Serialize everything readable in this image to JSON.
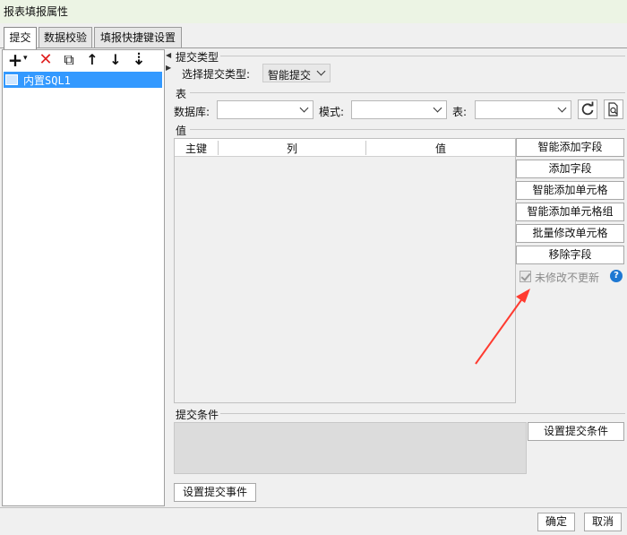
{
  "window": {
    "title": "报表填报属性"
  },
  "tabs": [
    {
      "label": "提交",
      "active": true
    },
    {
      "label": "数据校验",
      "active": false
    },
    {
      "label": "填报快捷键设置",
      "active": false
    }
  ],
  "toolbar": {
    "add": "+",
    "add_dropdown": "▾",
    "delete": "✕",
    "copy": "⧉",
    "move_up": "↑",
    "move_down": "↓",
    "sort": "⇣"
  },
  "tree": {
    "items": [
      {
        "label": "内置SQL1",
        "selected": true
      }
    ]
  },
  "submit_type": {
    "section_title": "提交类型",
    "label": "选择提交类型:",
    "value": "智能提交"
  },
  "table": {
    "section_title": "表",
    "database_label": "数据库:",
    "database_value": "",
    "schema_label": "模式:",
    "schema_value": "",
    "table_label": "表:",
    "table_value": ""
  },
  "values": {
    "section_title": "值",
    "columns": [
      "主键",
      "列",
      "值"
    ],
    "rows": []
  },
  "side_buttons": [
    "智能添加字段",
    "添加字段",
    "智能添加单元格",
    "智能添加单元格组",
    "批量修改单元格",
    "移除字段"
  ],
  "no_update_unmodified": {
    "label": "未修改不更新",
    "checked": true,
    "enabled": false
  },
  "help_icon": "?",
  "condition": {
    "section_title": "提交条件",
    "set_button": "设置提交条件"
  },
  "event_button": "设置提交事件",
  "footer": {
    "ok": "确定",
    "cancel": "取消"
  },
  "colors": {
    "selection": "#3399ff",
    "arrow": "#ff3b30",
    "help": "#1e78d2",
    "titlebar": "#ecf4e4"
  }
}
